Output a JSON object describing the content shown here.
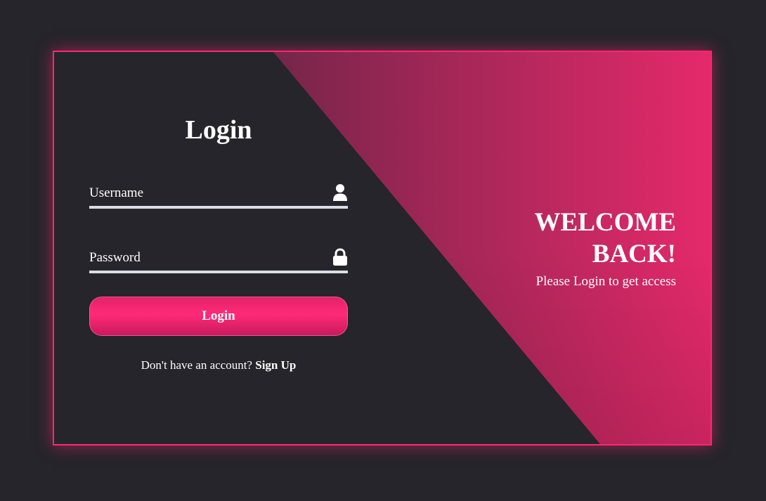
{
  "login_form": {
    "title": "Login",
    "username": {
      "placeholder": "Username",
      "value": "",
      "icon": "user-icon"
    },
    "password": {
      "placeholder": "Password",
      "value": "",
      "icon": "lock-icon"
    },
    "submit_label": "Login",
    "signup_prompt": "Don't have an account?",
    "signup_link": "Sign Up"
  },
  "welcome_panel": {
    "title_line1": "WELCOME",
    "title_line2": "BACK!",
    "subtitle": "Please Login to get access"
  },
  "colors": {
    "background": "#25252b",
    "accent": "#ff2770",
    "field_underline": "#d9dde6",
    "text": "#ffffff"
  }
}
